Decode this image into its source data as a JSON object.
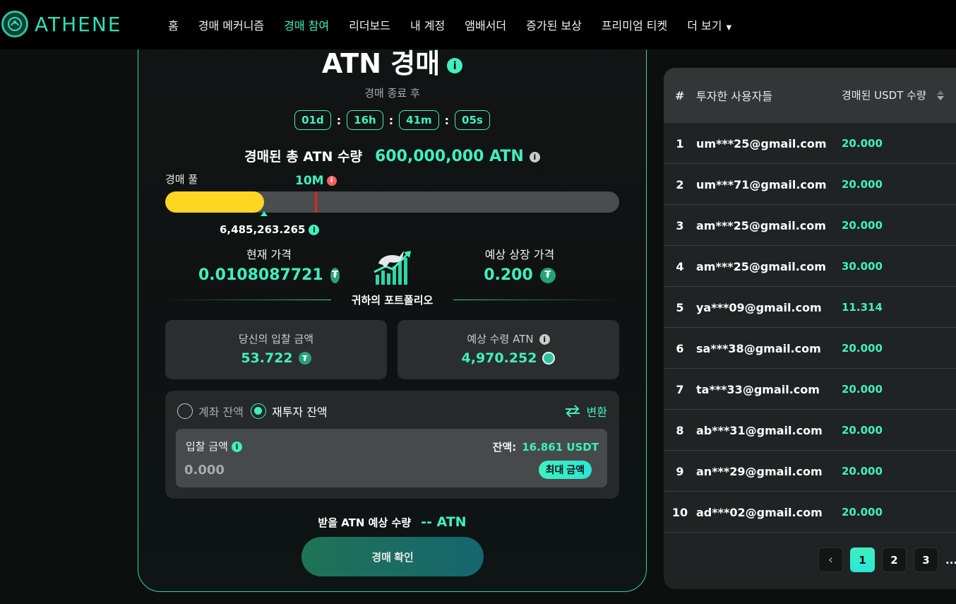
{
  "brand": {
    "name": "ATHENE",
    "accent": "#3ff0be"
  },
  "nav": {
    "items": [
      {
        "label": "홈",
        "active": false
      },
      {
        "label": "경매 메커니즘",
        "active": false
      },
      {
        "label": "경매 참여",
        "active": true
      },
      {
        "label": "리더보드",
        "active": false
      },
      {
        "label": "내 계정",
        "active": false
      },
      {
        "label": "앰배서더",
        "active": false
      },
      {
        "label": "증가된 보상",
        "active": false
      },
      {
        "label": "프리미엄 티켓",
        "active": false
      }
    ],
    "more_label": "더 보기",
    "more_icon": "caret-down-icon"
  },
  "auction": {
    "title": "ATN 경매",
    "ends_label": "경매 종료 후",
    "countdown": {
      "days": "01d",
      "hours": "16h",
      "minutes": "41m",
      "seconds": "05s"
    },
    "total_label": "경매된 총 ATN 수량",
    "total_value": "600,000,000 ATN",
    "pool_label": "경매 풀",
    "milestone_label": "10M",
    "pool_amount": "6,485,263.265",
    "pool_progress_fraction": 0.217,
    "milestone_fraction": 0.33,
    "current_price_label": "현재 가격",
    "current_price": "0.0108087721",
    "listing_price_label": "예상 상장 가격",
    "listing_price": "0.200",
    "portfolio_label": "귀하의 포트폴리오",
    "bid_amount_label": "당신의 입찰 금액",
    "bid_amount": "53.722",
    "expected_recv_label": "예상 수령 ATN",
    "expected_recv": "4,970.252",
    "balance_options": [
      {
        "label": "계좌 잔액",
        "selected": false
      },
      {
        "label": "재투자 잔액",
        "selected": true
      }
    ],
    "convert_label": "변환",
    "bid_input_label": "입찰 금액",
    "balance_key": "잔액:",
    "balance_value": "16.861 USDT",
    "bid_placeholder": "0.000",
    "max_label": "최대 금액",
    "expected_atn_label": "받을 ATN 예상 수량",
    "expected_atn_value": "-- ATN",
    "confirm_label": "경매 확인",
    "usdt_symbol": "₮"
  },
  "leaderboard": {
    "header": {
      "num": "#",
      "user": "투자한 사용자들",
      "amount": "경매된 USDT 수량"
    },
    "rows": [
      {
        "num": "1",
        "user": "um***25@gmail.com",
        "amount": "20.000"
      },
      {
        "num": "2",
        "user": "um***71@gmail.com",
        "amount": "20.000"
      },
      {
        "num": "3",
        "user": "am***25@gmail.com",
        "amount": "20.000"
      },
      {
        "num": "4",
        "user": "am***25@gmail.com",
        "amount": "30.000"
      },
      {
        "num": "5",
        "user": "ya***09@gmail.com",
        "amount": "11.314"
      },
      {
        "num": "6",
        "user": "sa***38@gmail.com",
        "amount": "20.000"
      },
      {
        "num": "7",
        "user": "ta***33@gmail.com",
        "amount": "20.000"
      },
      {
        "num": "8",
        "user": "ab***31@gmail.com",
        "amount": "20.000"
      },
      {
        "num": "9",
        "user": "an***29@gmail.com",
        "amount": "20.000"
      },
      {
        "num": "10",
        "user": "ad***02@gmail.com",
        "amount": "20.000"
      }
    ],
    "pages": [
      "1",
      "2",
      "3"
    ],
    "current_page": "1",
    "ellipsis": "..."
  }
}
